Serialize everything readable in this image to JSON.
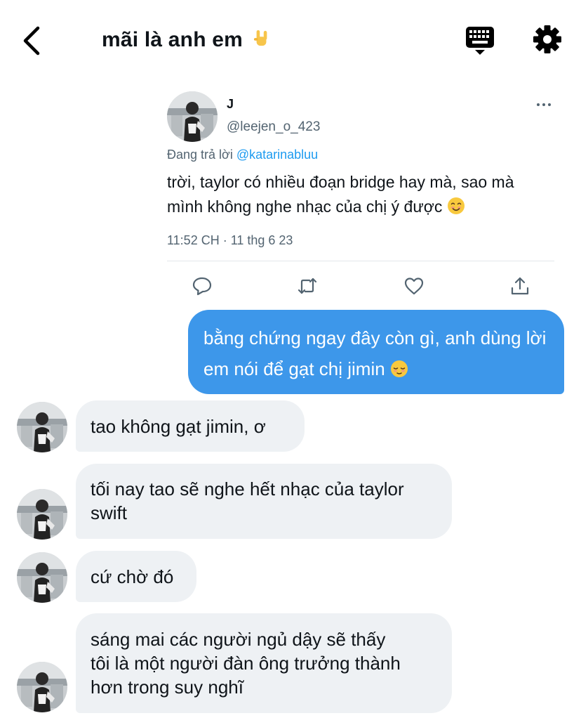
{
  "header": {
    "title": "mãi là anh em",
    "title_emoji": "rock-hand-emoji",
    "icons": [
      "back-chevron-icon",
      "keyboard-icon",
      "gear-icon"
    ]
  },
  "tweet": {
    "name": "J",
    "handle": "@leejen_o_423",
    "replying_prefix": "Đang trả lời ",
    "replying_to": "@katarinabluu",
    "text": "trời, taylor có nhiều đoạn bridge hay mà, sao mà mình không nghe nhạc của chị ý được",
    "text_emoji": "smiling-face-emoji",
    "timestamp": "11:52 CH · 11 thg 6 23",
    "actions": [
      "reply-icon",
      "retweet-icon",
      "like-icon",
      "share-icon"
    ]
  },
  "messages": [
    {
      "direction": "outgoing",
      "text": "bằng chứng ngay đây còn gì, anh dùng lời em nói để gạt chị jimin",
      "emoji": "relieved-face-emoji"
    },
    {
      "direction": "incoming",
      "text": "tao không gạt jimin, ơ"
    },
    {
      "direction": "incoming",
      "text": "tối nay tao sẽ nghe hết nhạc của taylor swift"
    },
    {
      "direction": "incoming",
      "text": "cứ chờ đó"
    },
    {
      "direction": "incoming",
      "text": "sáng mai các người ngủ dậy sẽ thấy tôi là một người đàn ông trưởng thành hơn trong suy nghĩ"
    }
  ],
  "colors": {
    "accent": "#1d9bf0",
    "outgoing_bubble": "#3d97ea",
    "incoming_bubble": "#eef1f4",
    "secondary_text": "#536471"
  }
}
